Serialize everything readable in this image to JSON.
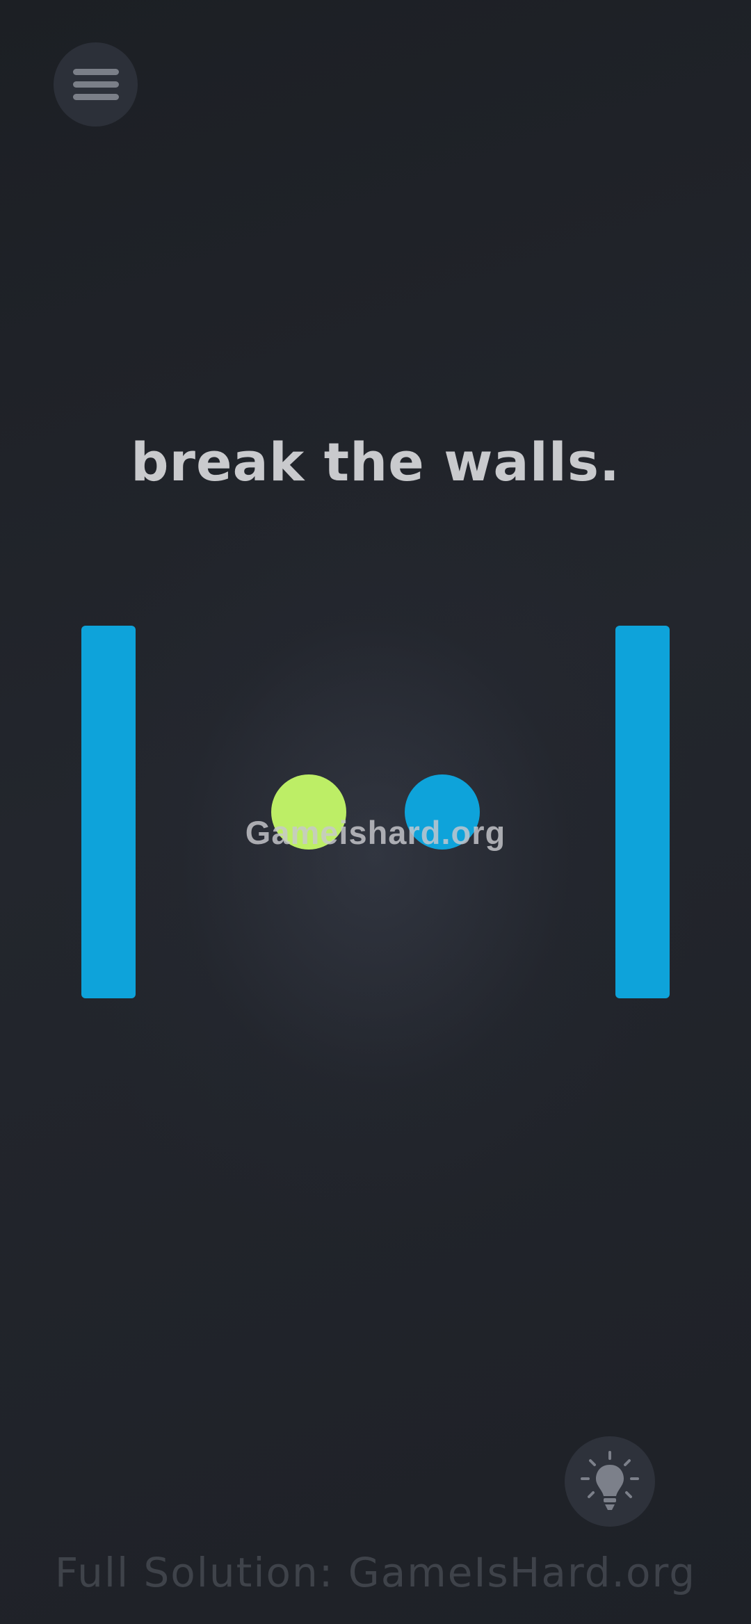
{
  "menu": {
    "icon": "hamburger-menu-icon"
  },
  "instruction": "break the walls.",
  "walls": {
    "color": "#0ea3da",
    "count": 2
  },
  "balls": [
    {
      "color": "#bdee66"
    },
    {
      "color": "#0ea3da"
    }
  ],
  "watermark": "Gameishard.org",
  "hint": {
    "icon": "lightbulb-icon"
  },
  "footer": "Full Solution: GameIsHard.org",
  "colors": {
    "background": "#1f2228",
    "accent_blue": "#0ea3da",
    "accent_green": "#bdee66",
    "text": "#c9cacd"
  }
}
